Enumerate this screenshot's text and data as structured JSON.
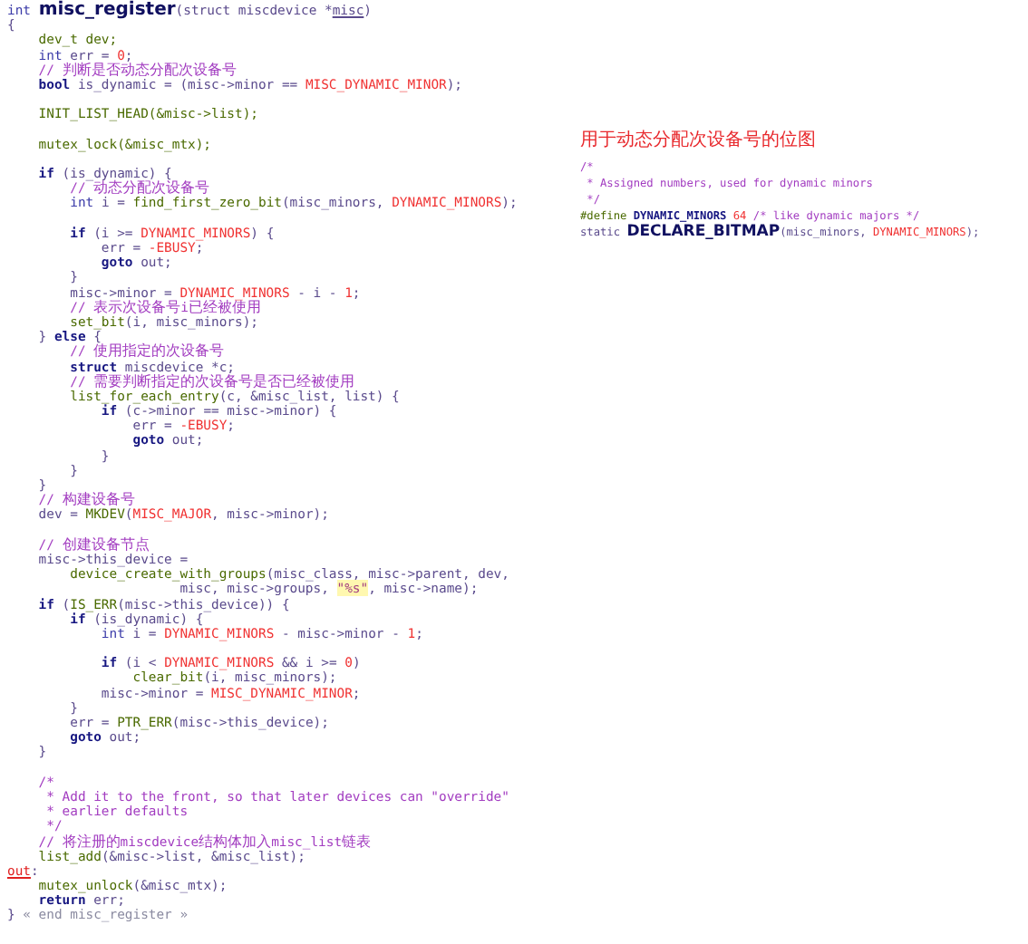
{
  "editor": {
    "lines": [
      {
        "tokens": [
          {
            "kind": "type",
            "text": "int "
          },
          {
            "kind": "title",
            "text": "misc_register"
          },
          {
            "kind": "p",
            "text": "(struct miscdevice *"
          },
          {
            "kind": "ul",
            "text": "misc"
          },
          {
            "kind": "p",
            "text": ")"
          }
        ]
      },
      {
        "tokens": [
          {
            "kind": "p",
            "text": "{"
          }
        ]
      },
      {
        "tokens": [
          {
            "kind": "fn",
            "text": "    dev_t dev;"
          }
        ]
      },
      {
        "tokens": [
          {
            "kind": "type",
            "text": "    int "
          },
          {
            "kind": "p",
            "text": "err = "
          },
          {
            "kind": "mac",
            "text": "0"
          },
          {
            "kind": "p",
            "text": ";"
          }
        ]
      },
      {
        "tokens": [
          {
            "kind": "cmt",
            "text": "    // 判断是否动态分配次设备号"
          }
        ]
      },
      {
        "tokens": [
          {
            "kind": "kw",
            "text": "    bool "
          },
          {
            "kind": "p",
            "text": "is_dynamic = (misc->minor == "
          },
          {
            "kind": "mac",
            "text": "MISC_DYNAMIC_MINOR"
          },
          {
            "kind": "p",
            "text": ");"
          }
        ]
      },
      {
        "space_before": true,
        "tokens": [
          {
            "kind": "fn",
            "text": "    INIT_LIST_HEAD(&misc->list);"
          }
        ]
      },
      {
        "space_before": true,
        "tokens": [
          {
            "kind": "fn",
            "text": "    mutex_lock(&misc_mtx);"
          }
        ]
      },
      {
        "space_before": true,
        "tokens": [
          {
            "kind": "kw",
            "text": "    if "
          },
          {
            "kind": "p",
            "text": "(is_dynamic) {"
          }
        ]
      },
      {
        "tokens": [
          {
            "kind": "cmt",
            "text": "        // 动态分配次设备号"
          }
        ]
      },
      {
        "tokens": [
          {
            "kind": "type",
            "text": "        int "
          },
          {
            "kind": "p",
            "text": "i = "
          },
          {
            "kind": "fn",
            "text": "find_first_zero_bit"
          },
          {
            "kind": "p",
            "text": "(misc_minors, "
          },
          {
            "kind": "mac",
            "text": "DYNAMIC_MINORS"
          },
          {
            "kind": "p",
            "text": ");"
          }
        ]
      },
      {
        "space_before": true,
        "tokens": [
          {
            "kind": "kw",
            "text": "        if "
          },
          {
            "kind": "p",
            "text": "(i >= "
          },
          {
            "kind": "mac",
            "text": "DYNAMIC_MINORS"
          },
          {
            "kind": "p",
            "text": ") {"
          }
        ]
      },
      {
        "tokens": [
          {
            "kind": "p",
            "text": "            err = "
          },
          {
            "kind": "mac",
            "text": "-EBUSY"
          },
          {
            "kind": "p",
            "text": ";"
          }
        ]
      },
      {
        "tokens": [
          {
            "kind": "kw",
            "text": "            goto "
          },
          {
            "kind": "p",
            "text": "out;"
          }
        ]
      },
      {
        "tokens": [
          {
            "kind": "p",
            "text": "        }"
          }
        ]
      },
      {
        "tokens": [
          {
            "kind": "p",
            "text": "        misc->minor = "
          },
          {
            "kind": "mac",
            "text": "DYNAMIC_MINORS"
          },
          {
            "kind": "p",
            "text": " - i - "
          },
          {
            "kind": "mac",
            "text": "1"
          },
          {
            "kind": "p",
            "text": ";"
          }
        ]
      },
      {
        "tokens": [
          {
            "kind": "cmt",
            "text": "        // 表示次设备号i已经被使用"
          }
        ]
      },
      {
        "tokens": [
          {
            "kind": "fn",
            "text": "        set_bit"
          },
          {
            "kind": "p",
            "text": "(i, misc_minors);"
          }
        ]
      },
      {
        "tokens": [
          {
            "kind": "p",
            "text": "    } "
          },
          {
            "kind": "kw",
            "text": "else"
          },
          {
            "kind": "p",
            "text": " {"
          }
        ]
      },
      {
        "tokens": [
          {
            "kind": "cmt",
            "text": "        // 使用指定的次设备号"
          }
        ]
      },
      {
        "tokens": [
          {
            "kind": "kw",
            "text": "        struct "
          },
          {
            "kind": "p",
            "text": "miscdevice *c;"
          }
        ]
      },
      {
        "tokens": [
          {
            "kind": "cmt",
            "text": "        // 需要判断指定的次设备号是否已经被使用"
          }
        ]
      },
      {
        "tokens": [
          {
            "kind": "fn",
            "text": "        list_for_each_entry"
          },
          {
            "kind": "p",
            "text": "(c, &misc_list, list) {"
          }
        ]
      },
      {
        "tokens": [
          {
            "kind": "kw",
            "text": "            if "
          },
          {
            "kind": "p",
            "text": "(c->minor == misc->minor) {"
          }
        ]
      },
      {
        "tokens": [
          {
            "kind": "p",
            "text": "                err = "
          },
          {
            "kind": "mac",
            "text": "-EBUSY"
          },
          {
            "kind": "p",
            "text": ";"
          }
        ]
      },
      {
        "tokens": [
          {
            "kind": "kw",
            "text": "                goto "
          },
          {
            "kind": "p",
            "text": "out;"
          }
        ]
      },
      {
        "tokens": [
          {
            "kind": "p",
            "text": "            }"
          }
        ]
      },
      {
        "tokens": [
          {
            "kind": "p",
            "text": "        }"
          }
        ]
      },
      {
        "tokens": [
          {
            "kind": "p",
            "text": "    }"
          }
        ]
      },
      {
        "tokens": [
          {
            "kind": "cmt",
            "text": "    // 构建设备号"
          }
        ]
      },
      {
        "tokens": [
          {
            "kind": "p",
            "text": "    dev = "
          },
          {
            "kind": "fn",
            "text": "MKDEV"
          },
          {
            "kind": "p",
            "text": "("
          },
          {
            "kind": "mac",
            "text": "MISC_MAJOR"
          },
          {
            "kind": "p",
            "text": ", misc->minor);"
          }
        ]
      },
      {
        "space_before": true,
        "tokens": [
          {
            "kind": "cmt",
            "text": "    // 创建设备节点"
          }
        ]
      },
      {
        "tokens": [
          {
            "kind": "p",
            "text": "    misc->this_device ="
          }
        ]
      },
      {
        "tokens": [
          {
            "kind": "fn",
            "text": "        device_create_with_groups"
          },
          {
            "kind": "p",
            "text": "(misc_class, misc->parent, dev,"
          }
        ]
      },
      {
        "tokens": [
          {
            "kind": "p",
            "text": "                      misc, misc->groups, "
          },
          {
            "kind": "str",
            "text": "\"%s\""
          },
          {
            "kind": "p",
            "text": ", misc->name);"
          }
        ]
      },
      {
        "tokens": [
          {
            "kind": "kw",
            "text": "    if "
          },
          {
            "kind": "p",
            "text": "("
          },
          {
            "kind": "fn",
            "text": "IS_ERR"
          },
          {
            "kind": "p",
            "text": "(misc->this_device)) {"
          }
        ]
      },
      {
        "tokens": [
          {
            "kind": "kw",
            "text": "        if "
          },
          {
            "kind": "p",
            "text": "(is_dynamic) {"
          }
        ]
      },
      {
        "tokens": [
          {
            "kind": "type",
            "text": "            int "
          },
          {
            "kind": "p",
            "text": "i = "
          },
          {
            "kind": "mac",
            "text": "DYNAMIC_MINORS"
          },
          {
            "kind": "p",
            "text": " - misc->minor - "
          },
          {
            "kind": "mac",
            "text": "1"
          },
          {
            "kind": "p",
            "text": ";"
          }
        ]
      },
      {
        "space_before": true,
        "tokens": [
          {
            "kind": "kw",
            "text": "            if "
          },
          {
            "kind": "p",
            "text": "(i < "
          },
          {
            "kind": "mac",
            "text": "DYNAMIC_MINORS"
          },
          {
            "kind": "p",
            "text": " && i >= "
          },
          {
            "kind": "mac",
            "text": "0"
          },
          {
            "kind": "p",
            "text": ")"
          }
        ]
      },
      {
        "tokens": [
          {
            "kind": "fn",
            "text": "                clear_bit"
          },
          {
            "kind": "p",
            "text": "(i, misc_minors);"
          }
        ]
      },
      {
        "tokens": [
          {
            "kind": "p",
            "text": "            misc->minor = "
          },
          {
            "kind": "mac",
            "text": "MISC_DYNAMIC_MINOR"
          },
          {
            "kind": "p",
            "text": ";"
          }
        ]
      },
      {
        "tokens": [
          {
            "kind": "p",
            "text": "        }"
          }
        ]
      },
      {
        "tokens": [
          {
            "kind": "p",
            "text": "        err = "
          },
          {
            "kind": "fn",
            "text": "PTR_ERR"
          },
          {
            "kind": "p",
            "text": "(misc->this_device);"
          }
        ]
      },
      {
        "tokens": [
          {
            "kind": "kw",
            "text": "        goto "
          },
          {
            "kind": "p",
            "text": "out;"
          }
        ]
      },
      {
        "tokens": [
          {
            "kind": "p",
            "text": "    }"
          }
        ]
      },
      {
        "space_before": true,
        "tokens": [
          {
            "kind": "cmt",
            "text": "    /*"
          }
        ]
      },
      {
        "tokens": [
          {
            "kind": "cmt",
            "text": "     * Add it to the front, so that later devices can \"override\""
          }
        ]
      },
      {
        "tokens": [
          {
            "kind": "cmt",
            "text": "     * earlier defaults"
          }
        ]
      },
      {
        "tokens": [
          {
            "kind": "cmt",
            "text": "     */"
          }
        ]
      },
      {
        "tokens": [
          {
            "kind": "cmt",
            "text": "    // 将注册的miscdevice结构体加入misc_list链表"
          }
        ]
      },
      {
        "tokens": [
          {
            "kind": "fn",
            "text": "    list_add"
          },
          {
            "kind": "p",
            "text": "(&misc->list, &misc_list);"
          }
        ]
      },
      {
        "tokens": [
          {
            "kind": "lbl",
            "text": "out"
          },
          {
            "kind": "p",
            "text": ":"
          }
        ]
      },
      {
        "tokens": [
          {
            "kind": "fn",
            "text": "    mutex_unlock"
          },
          {
            "kind": "p",
            "text": "(&misc_mtx);"
          }
        ]
      },
      {
        "tokens": [
          {
            "kind": "kw",
            "text": "    return "
          },
          {
            "kind": "p",
            "text": "err;"
          }
        ]
      },
      {
        "tokens": [
          {
            "kind": "p",
            "text": "} "
          },
          {
            "kind": "end",
            "text": "« end misc_register »"
          }
        ]
      }
    ]
  },
  "side_note": {
    "caption": "用于动态分配次设备号的位图",
    "lines": [
      {
        "tokens": [
          {
            "kind": "cmt",
            "text": "/*"
          }
        ]
      },
      {
        "tokens": [
          {
            "kind": "cmt",
            "text": " * Assigned numbers, used for dynamic minors"
          }
        ]
      },
      {
        "tokens": [
          {
            "kind": "cmt",
            "text": " */"
          }
        ]
      },
      {
        "tokens": [
          {
            "kind": "fn",
            "text": "#define "
          },
          {
            "kind": "kw",
            "text": "DYNAMIC_MINORS "
          },
          {
            "kind": "mac",
            "text": "64"
          },
          {
            "kind": "cmt",
            "text": " /* like dynamic majors */"
          }
        ]
      },
      {
        "tokens": [
          {
            "kind": "p",
            "text": "static "
          },
          {
            "kind": "title",
            "text": "DECLARE_BITMAP"
          },
          {
            "kind": "p",
            "text": "(misc_minors, "
          },
          {
            "kind": "mac",
            "text": "DYNAMIC_MINORS"
          },
          {
            "kind": "p",
            "text": ");"
          }
        ]
      }
    ]
  }
}
